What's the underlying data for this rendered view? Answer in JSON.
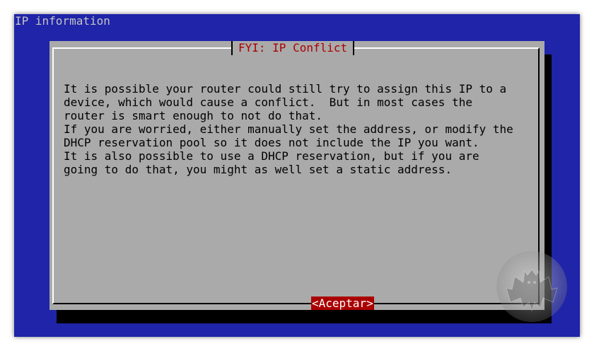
{
  "screen": {
    "backtitle": "IP information",
    "background_color": "#1f24a8"
  },
  "dialog": {
    "title": "FYI: IP Conflict",
    "message": "It is possible your router could still try to assign this IP to a\ndevice, which would cause a conflict.  But in most cases the\nrouter is smart enough to not do that.\nIf you are worried, either manually set the address, or modify the\nDHCP reservation pool so it does not include the IP you want.\nIt is also possible to use a DHCP reservation, but if you are\ngoing to do that, you might as well set a static address.",
    "button_label": "<Aceptar>",
    "title_color": "#aa0000",
    "button_color": "#aa0000",
    "panel_color": "#aaaaaa"
  },
  "watermark": {
    "icon": "bat-logo-icon"
  }
}
